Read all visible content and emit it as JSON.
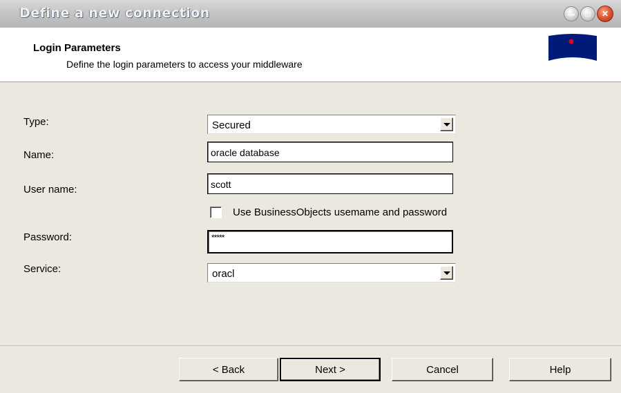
{
  "window": {
    "title": "Define a new connection"
  },
  "header": {
    "title": "Login Parameters",
    "subtitle": "Define the login parameters to access your middleware"
  },
  "form": {
    "type": {
      "label": "Type:",
      "value": "Secured"
    },
    "name": {
      "label": "Name:",
      "value": "oracle database"
    },
    "user_name": {
      "label": "User name:",
      "value": "scott"
    },
    "use_bo_credentials": {
      "label": "Use BusinessObjects usemame and password",
      "checked": false
    },
    "password": {
      "label": "Password:",
      "value": "*****"
    },
    "service": {
      "label": "Service:",
      "value": "oracl"
    }
  },
  "buttons": {
    "back": "< Back",
    "next": "Next >",
    "cancel": "Cancel",
    "help": "Help"
  },
  "colors": {
    "dialog_background": "#ebe8df",
    "header_background": "#ffffff",
    "logo_blue": "#001a7a",
    "logo_dot": "#e0002a"
  },
  "icons": {
    "minimize": "minimize-icon",
    "maximize": "maximize-icon",
    "close": "close-icon",
    "dropdown": "chevron-down-icon",
    "logo": "logo-icon"
  }
}
